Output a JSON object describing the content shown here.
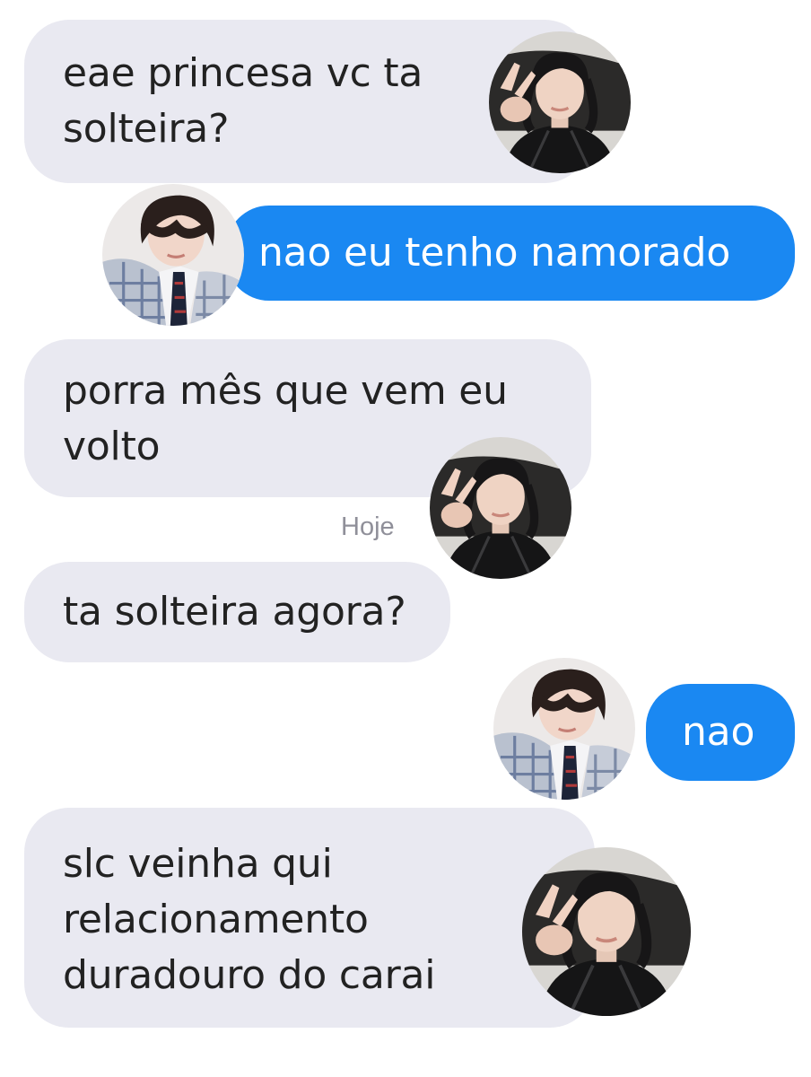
{
  "conversation": {
    "messages": [
      {
        "sender": "them",
        "lines": [
          "eae princesa vc ta",
          "solteira?"
        ]
      },
      {
        "sender": "me",
        "lines": [
          "nao eu tenho namorado"
        ]
      },
      {
        "sender": "them",
        "lines": [
          "porra mês que vem eu",
          "volto"
        ]
      },
      {
        "sender": "them",
        "lines": [
          "ta solteira agora?"
        ]
      },
      {
        "sender": "me",
        "lines": [
          "nao"
        ]
      },
      {
        "sender": "them",
        "lines": [
          "slc veinha qui",
          "relacionamento",
          "duradouro do carai"
        ]
      }
    ],
    "day_separator": "Hoje"
  },
  "avatars": {
    "them": {
      "icon": "contact-avatar-black-hoodie-peace-sign"
    },
    "me": {
      "icon": "user-avatar-plaid-jacket-tie"
    }
  },
  "colors": {
    "incoming_bubble": "#e9e9f1",
    "outgoing_bubble": "#1a88f2",
    "incoming_text": "#222222",
    "outgoing_text": "#ffffff",
    "separator_text": "#8f8f99"
  }
}
